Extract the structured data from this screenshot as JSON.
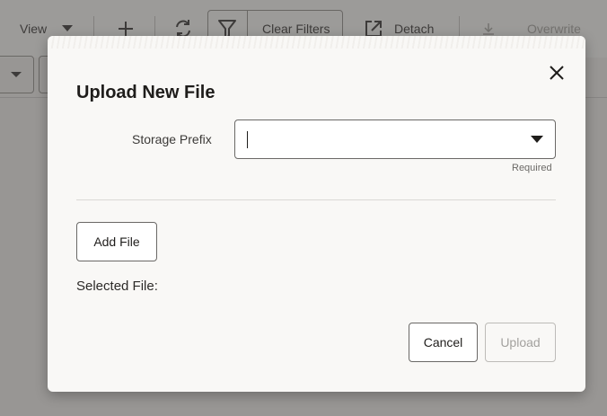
{
  "toolbar": {
    "view_label": "View",
    "clear_filters_label": "Clear Filters",
    "detach_label": "Detach",
    "overwrite_label": "Overwrite"
  },
  "dialog": {
    "title": "Upload New File",
    "storage_prefix_label": "Storage Prefix",
    "storage_prefix_value": "",
    "required_text": "Required",
    "add_file_label": "Add File",
    "selected_file_label": "Selected File:",
    "cancel_label": "Cancel",
    "upload_label": "Upload",
    "upload_enabled": false
  },
  "icons": {
    "view_dropdown": "chevron-down-icon",
    "add": "plus-icon",
    "refresh": "refresh-icon",
    "filter": "filter-icon",
    "detach": "detach-icon",
    "download": "download-icon",
    "close": "close-icon",
    "select": "chevron-down-icon"
  },
  "colors": {
    "dialog_bg": "#f9f8f6",
    "backdrop": "#a9a7a4",
    "text_primary": "#1f1d1b",
    "disabled_text": "#a3a19e"
  }
}
